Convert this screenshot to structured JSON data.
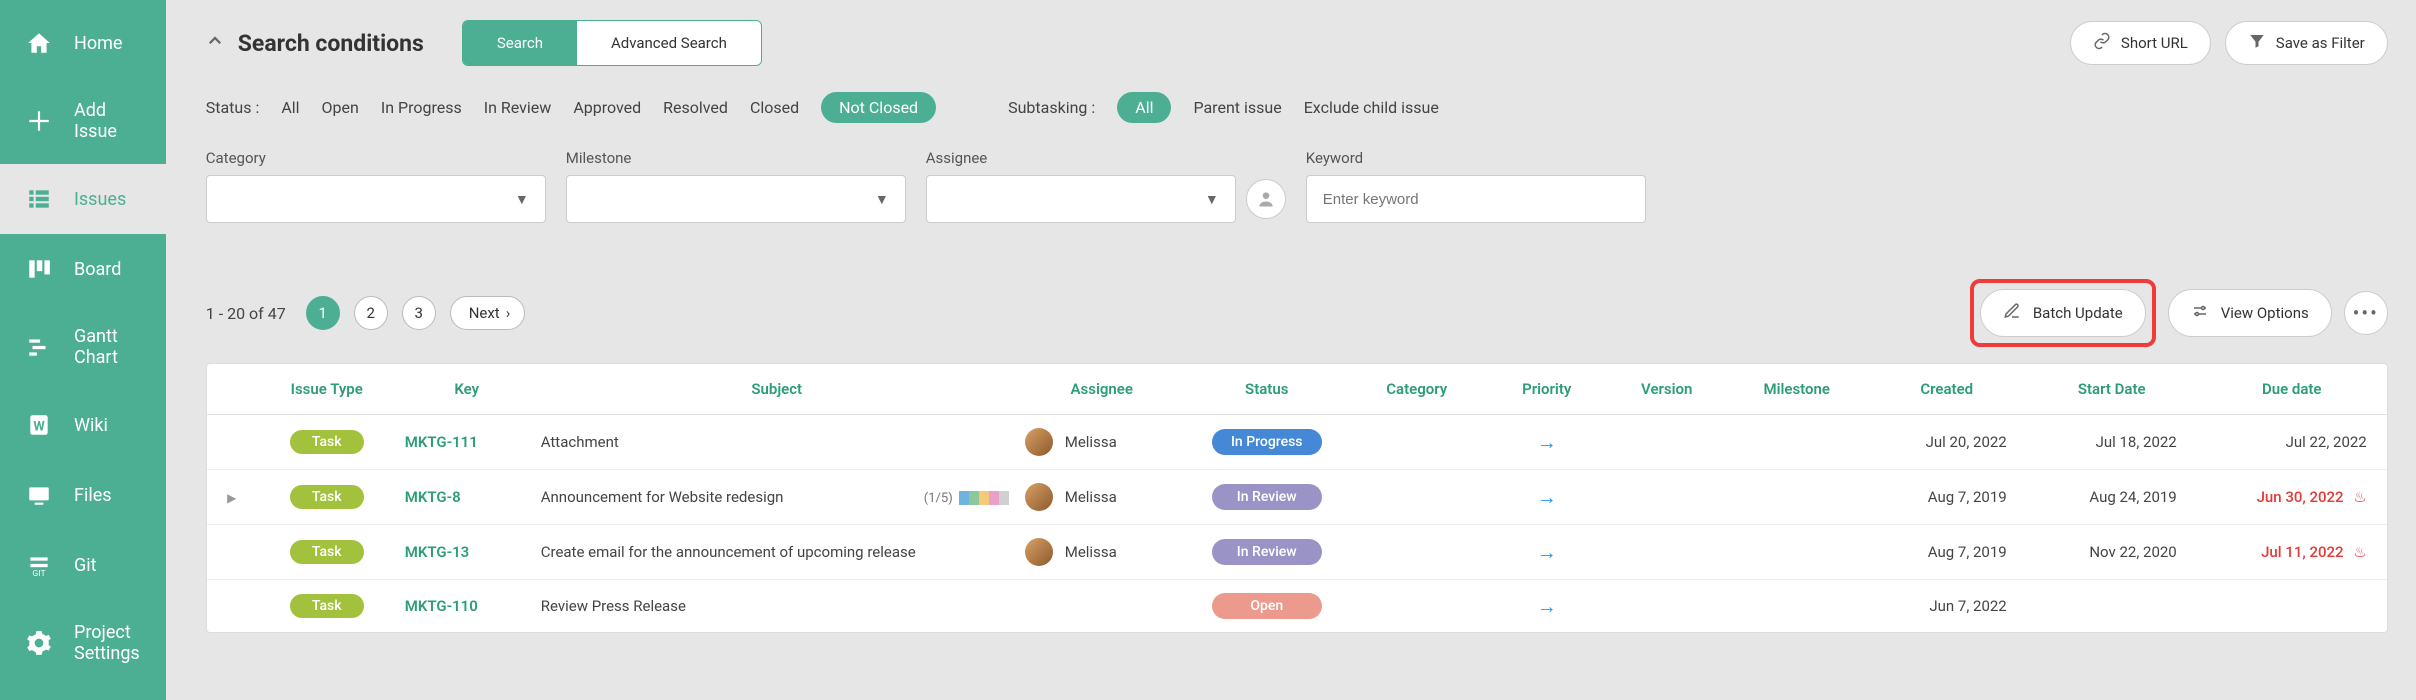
{
  "sidebar": {
    "items": [
      {
        "label": "Home"
      },
      {
        "label": "Add Issue"
      },
      {
        "label": "Issues"
      },
      {
        "label": "Board"
      },
      {
        "label": "Gantt Chart"
      },
      {
        "label": "Wiki"
      },
      {
        "label": "Files"
      },
      {
        "label": "Git"
      },
      {
        "label": "Project Settings"
      }
    ]
  },
  "header": {
    "title": "Search conditions",
    "tab_search": "Search",
    "tab_advanced": "Advanced Search",
    "short_url": "Short URL",
    "save_filter": "Save as Filter"
  },
  "status_filter": {
    "label": "Status :",
    "options": [
      "All",
      "Open",
      "In Progress",
      "In Review",
      "Approved",
      "Resolved",
      "Closed",
      "Not Closed"
    ],
    "active": "Not Closed",
    "subtask_label": "Subtasking :",
    "subtask_options": [
      "All",
      "Parent issue",
      "Exclude child issue"
    ],
    "subtask_active": "All"
  },
  "filters": {
    "category": "Category",
    "milestone": "Milestone",
    "assignee": "Assignee",
    "keyword_label": "Keyword",
    "keyword_placeholder": "Enter keyword"
  },
  "pagination": {
    "range": "1 - 20 of 47",
    "pages": [
      "1",
      "2",
      "3"
    ],
    "active": "1",
    "next": "Next"
  },
  "actions": {
    "batch_update": "Batch Update",
    "view_options": "View Options"
  },
  "table": {
    "headers": [
      "Issue Type",
      "Key",
      "Subject",
      "Assignee",
      "Status",
      "Category",
      "Priority",
      "Version",
      "Milestone",
      "Created",
      "Start Date",
      "Due date"
    ],
    "rows": [
      {
        "type": "Task",
        "key": "MKTG-111",
        "subject": "Attachment",
        "assignee": "Melissa",
        "status": "In Progress",
        "status_class": "inprogress",
        "created": "Jul 20, 2022",
        "start": "Jul 18, 2022",
        "due": "Jul 22, 2022",
        "overdue": false,
        "flame": false,
        "expand": false,
        "progress": ""
      },
      {
        "type": "Task",
        "key": "MKTG-8",
        "subject": "Announcement for Website redesign",
        "assignee": "Melissa",
        "status": "In Review",
        "status_class": "inreview",
        "created": "Aug 7, 2019",
        "start": "Aug 24, 2019",
        "due": "Jun 30, 2022",
        "overdue": true,
        "flame": true,
        "expand": true,
        "progress": "(1/5)"
      },
      {
        "type": "Task",
        "key": "MKTG-13",
        "subject": "Create email for the announcement of upcoming release",
        "assignee": "Melissa",
        "status": "In Review",
        "status_class": "inreview",
        "created": "Aug 7, 2019",
        "start": "Nov 22, 2020",
        "due": "Jul 11, 2022",
        "overdue": true,
        "flame": true,
        "expand": false,
        "progress": ""
      },
      {
        "type": "Task",
        "key": "MKTG-110",
        "subject": "Review Press Release",
        "assignee": "",
        "status": "Open",
        "status_class": "open",
        "created": "Jun 7, 2022",
        "start": "",
        "due": "",
        "overdue": false,
        "flame": false,
        "expand": false,
        "progress": ""
      }
    ]
  }
}
